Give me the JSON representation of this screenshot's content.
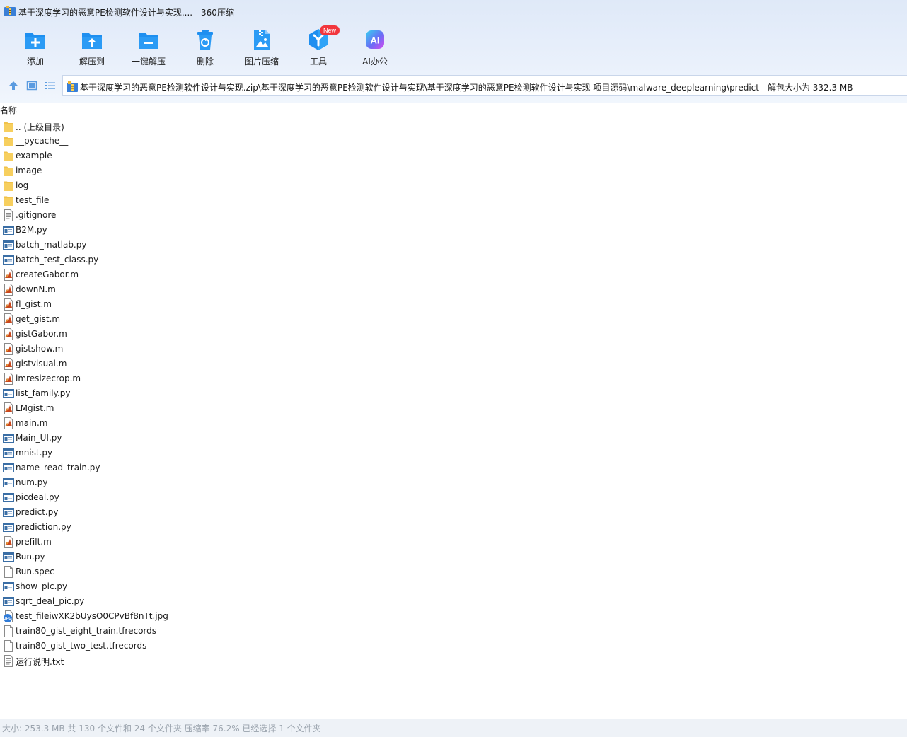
{
  "window": {
    "title": "基于深度学习的恶意PE检测软件设计与实现.... - 360压缩"
  },
  "toolbar": {
    "items": [
      {
        "label": "添加",
        "icon": "add-icon"
      },
      {
        "label": "解压到",
        "icon": "extract-to-icon"
      },
      {
        "label": "一键解压",
        "icon": "one-click-extract-icon"
      },
      {
        "label": "删除",
        "icon": "delete-icon"
      },
      {
        "label": "图片压缩",
        "icon": "image-compress-icon"
      },
      {
        "label": "工具",
        "icon": "tools-icon",
        "badge": "New"
      },
      {
        "label": "AI办公",
        "icon": "ai-office-icon",
        "icon_text": "AI"
      }
    ]
  },
  "colors": {
    "accent": "#1e8ff0",
    "badge": "#f2363d",
    "folder": "#f7cf5e"
  },
  "address": {
    "path": "基于深度学习的恶意PE检测软件设计与实现.zip\\基于深度学习的恶意PE检测软件设计与实现\\基于深度学习的恶意PE检测软件设计与实现 项目源码\\malware_deeplearning\\predict - 解包大小为 332.3 MB"
  },
  "list": {
    "column_name": "名称",
    "files": [
      {
        "name": ".. (上级目录)",
        "icon": "folder-icon"
      },
      {
        "name": "__pycache__",
        "icon": "folder-icon"
      },
      {
        "name": "example",
        "icon": "folder-icon"
      },
      {
        "name": "image",
        "icon": "folder-icon"
      },
      {
        "name": "log",
        "icon": "folder-icon"
      },
      {
        "name": "test_file",
        "icon": "folder-icon"
      },
      {
        "name": ".gitignore",
        "icon": "text-file-icon"
      },
      {
        "name": "B2M.py",
        "icon": "python-file-icon"
      },
      {
        "name": "batch_matlab.py",
        "icon": "python-file-icon"
      },
      {
        "name": "batch_test_class.py",
        "icon": "python-file-icon"
      },
      {
        "name": "createGabor.m",
        "icon": "matlab-file-icon"
      },
      {
        "name": "downN.m",
        "icon": "matlab-file-icon"
      },
      {
        "name": "fl_gist.m",
        "icon": "matlab-file-icon"
      },
      {
        "name": "get_gist.m",
        "icon": "matlab-file-icon"
      },
      {
        "name": "gistGabor.m",
        "icon": "matlab-file-icon"
      },
      {
        "name": "gistshow.m",
        "icon": "matlab-file-icon"
      },
      {
        "name": "gistvisual.m",
        "icon": "matlab-file-icon"
      },
      {
        "name": "imresizecrop.m",
        "icon": "matlab-file-icon"
      },
      {
        "name": "list_family.py",
        "icon": "python-file-icon"
      },
      {
        "name": "LMgist.m",
        "icon": "matlab-file-icon"
      },
      {
        "name": "main.m",
        "icon": "matlab-file-icon"
      },
      {
        "name": "Main_UI.py",
        "icon": "python-file-icon"
      },
      {
        "name": "mnist.py",
        "icon": "python-file-icon"
      },
      {
        "name": "name_read_train.py",
        "icon": "python-file-icon"
      },
      {
        "name": "num.py",
        "icon": "python-file-icon"
      },
      {
        "name": "picdeal.py",
        "icon": "python-file-icon"
      },
      {
        "name": "predict.py",
        "icon": "python-file-icon"
      },
      {
        "name": "prediction.py",
        "icon": "python-file-icon"
      },
      {
        "name": "prefilt.m",
        "icon": "matlab-file-icon"
      },
      {
        "name": "Run.py",
        "icon": "python-file-icon"
      },
      {
        "name": "Run.spec",
        "icon": "blank-file-icon"
      },
      {
        "name": "show_pic.py",
        "icon": "python-file-icon"
      },
      {
        "name": "sqrt_deal_pic.py",
        "icon": "python-file-icon"
      },
      {
        "name": "test_fileiwXK2bUysO0CPvBf8nTt.jpg",
        "icon": "jpg-file-icon",
        "icon_text": "JPG"
      },
      {
        "name": "train80_gist_eight_train.tfrecords",
        "icon": "blank-file-icon"
      },
      {
        "name": "train80_gist_two_test.tfrecords",
        "icon": "blank-file-icon"
      },
      {
        "name": "运行说明.txt",
        "icon": "text-file-icon"
      }
    ]
  },
  "status": {
    "text": "大小: 253.3 MB 共 130 个文件和 24 个文件夹 压缩率 76.2% 已经选择 1 个文件夹"
  }
}
